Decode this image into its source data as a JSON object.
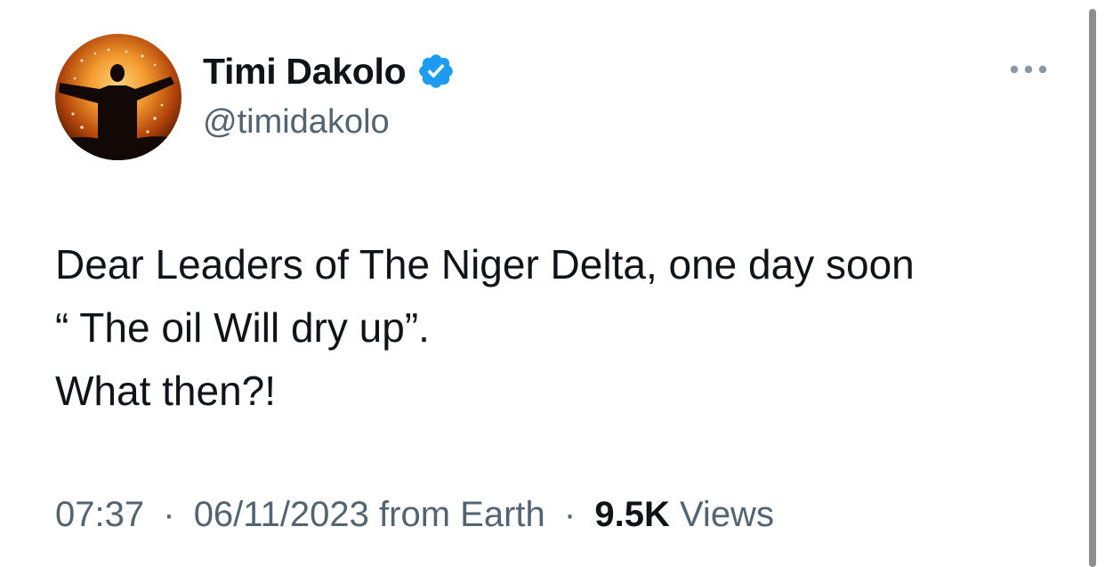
{
  "author": {
    "display_name": "Timi Dakolo",
    "handle": "@timidakolo",
    "verified": true,
    "avatar_icon": "avatar-concert-silhouette",
    "badge_color": "#1d9bf0"
  },
  "more_icon": "more-horizontal-icon",
  "tweet": {
    "lines": [
      "Dear Leaders of The Niger Delta, one day soon",
      "“ The oil Will dry up”.",
      "What then?!"
    ]
  },
  "meta": {
    "time": "07:37",
    "separator": "·",
    "date": "06/11/2023",
    "source": "from Earth",
    "views_count": "9.5K",
    "views_label": "Views"
  },
  "colors": {
    "text": "#0f1419",
    "secondary": "#536471",
    "accent": "#1d9bf0"
  }
}
